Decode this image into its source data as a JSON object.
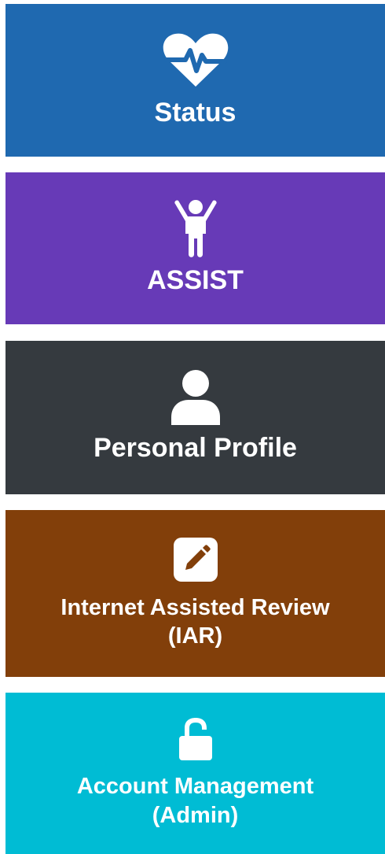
{
  "colors": {
    "status": "#1F69B0",
    "assist": "#673AB7",
    "profile": "#353A3F",
    "iar": "#823F0A",
    "account": "#00BCD4",
    "text": "#FFFFFF"
  },
  "tiles": [
    {
      "id": "status",
      "icon": "heartbeat-icon",
      "lines": [
        "Status"
      ]
    },
    {
      "id": "assist",
      "icon": "child-icon",
      "lines": [
        "ASSIST"
      ]
    },
    {
      "id": "profile",
      "icon": "user-icon",
      "lines": [
        "Personal Profile"
      ]
    },
    {
      "id": "iar",
      "icon": "pencil-square-icon",
      "lines": [
        "Internet Assisted Review",
        "(IAR)"
      ]
    },
    {
      "id": "account",
      "icon": "unlock-icon",
      "lines": [
        "Account Management",
        "(Admin)"
      ]
    }
  ]
}
